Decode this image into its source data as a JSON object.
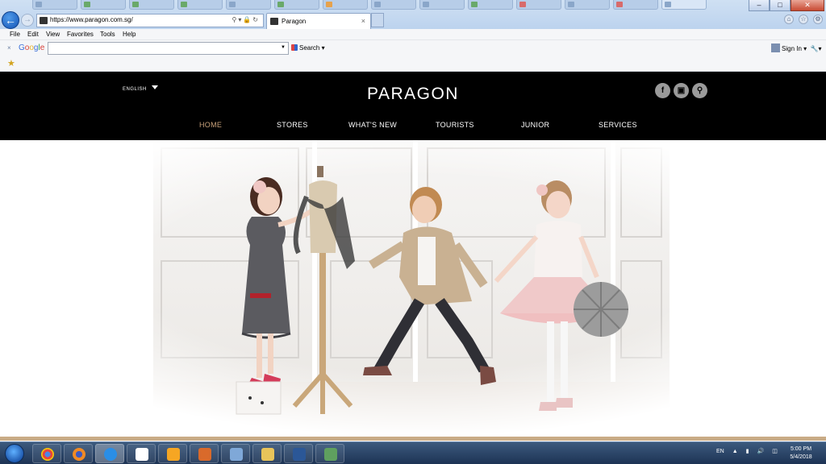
{
  "browser": {
    "url": "https://www.paragon.com.sg/",
    "active_tab_title": "Paragon",
    "active_tab_close": "×",
    "menu": [
      "File",
      "Edit",
      "View",
      "Favorites",
      "Tools",
      "Help"
    ],
    "window_controls": {
      "minimize": "–",
      "maximize": "□",
      "close": "✕"
    },
    "toolbar_icons": [
      "home-icon",
      "favorites-star-icon",
      "tools-gear-icon"
    ]
  },
  "google_toolbar": {
    "close": "×",
    "logo": "Google",
    "search_value": "",
    "search_label": "Search",
    "sign_in_label": "Sign In"
  },
  "site": {
    "language": "ENGLISH",
    "logo": "PARAGON",
    "social_icons": [
      "facebook-icon",
      "instagram-icon",
      "search-icon"
    ],
    "nav": [
      {
        "label": "HOME",
        "active": true
      },
      {
        "label": "STORES",
        "active": false
      },
      {
        "label": "WHAT'S NEW",
        "active": false
      },
      {
        "label": "TOURISTS",
        "active": false
      },
      {
        "label": "JUNIOR",
        "active": false
      },
      {
        "label": "SERVICES",
        "active": false
      }
    ],
    "accent_color": "#c9a27a",
    "header_bg": "#000000"
  },
  "taskbar": {
    "apps": [
      "chrome-icon",
      "firefox-icon",
      "internet-explorer-icon",
      "dropbox-icon",
      "media-player-icon",
      "package-icon",
      "window-switcher-icon",
      "file-explorer-icon",
      "word-icon",
      "photo-viewer-icon"
    ],
    "language": "EN",
    "time": "5:00 PM",
    "date": "5/4/2018"
  }
}
